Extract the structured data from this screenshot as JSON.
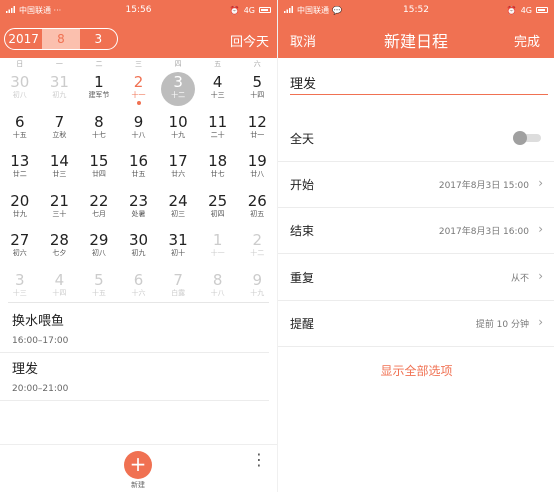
{
  "colors": {
    "accent": "#f07152",
    "selected_day": "#bdbdbd"
  },
  "left": {
    "status": {
      "carrier": "中国联通 ···",
      "time": "15:56",
      "network": "4G"
    },
    "header": {
      "year": "2017",
      "month": "8",
      "view": "3",
      "back_today": "回今天"
    },
    "weekdays": [
      "日",
      "一",
      "二",
      "三",
      "四",
      "五",
      "六"
    ],
    "calendar": [
      [
        {
          "n": "30",
          "l": "初八",
          "dim": true
        },
        {
          "n": "31",
          "l": "初九",
          "dim": true
        },
        {
          "n": "1",
          "l": "建军节"
        },
        {
          "n": "2",
          "l": "十一",
          "today": true,
          "dot": true
        },
        {
          "n": "3",
          "l": "十二",
          "sel": true
        },
        {
          "n": "4",
          "l": "十三"
        },
        {
          "n": "5",
          "l": "十四"
        }
      ],
      [
        {
          "n": "6",
          "l": "十五"
        },
        {
          "n": "7",
          "l": "立秋"
        },
        {
          "n": "8",
          "l": "十七"
        },
        {
          "n": "9",
          "l": "十八"
        },
        {
          "n": "10",
          "l": "十九"
        },
        {
          "n": "11",
          "l": "二十"
        },
        {
          "n": "12",
          "l": "廿一"
        }
      ],
      [
        {
          "n": "13",
          "l": "廿二"
        },
        {
          "n": "14",
          "l": "廿三"
        },
        {
          "n": "15",
          "l": "廿四"
        },
        {
          "n": "16",
          "l": "廿五"
        },
        {
          "n": "17",
          "l": "廿六"
        },
        {
          "n": "18",
          "l": "廿七"
        },
        {
          "n": "19",
          "l": "廿八"
        }
      ],
      [
        {
          "n": "20",
          "l": "廿九"
        },
        {
          "n": "21",
          "l": "三十"
        },
        {
          "n": "22",
          "l": "七月"
        },
        {
          "n": "23",
          "l": "处暑"
        },
        {
          "n": "24",
          "l": "初三"
        },
        {
          "n": "25",
          "l": "初四"
        },
        {
          "n": "26",
          "l": "初五"
        }
      ],
      [
        {
          "n": "27",
          "l": "初六"
        },
        {
          "n": "28",
          "l": "七夕"
        },
        {
          "n": "29",
          "l": "初八"
        },
        {
          "n": "30",
          "l": "初九"
        },
        {
          "n": "31",
          "l": "初十"
        },
        {
          "n": "1",
          "l": "十一",
          "dim": true
        },
        {
          "n": "2",
          "l": "十二",
          "dim": true
        }
      ],
      [
        {
          "n": "3",
          "l": "十三",
          "dim": true
        },
        {
          "n": "4",
          "l": "十四",
          "dim": true
        },
        {
          "n": "5",
          "l": "十五",
          "dim": true
        },
        {
          "n": "6",
          "l": "十六",
          "dim": true
        },
        {
          "n": "7",
          "l": "白露",
          "dim": true
        },
        {
          "n": "8",
          "l": "十八",
          "dim": true
        },
        {
          "n": "9",
          "l": "十九",
          "dim": true
        }
      ]
    ],
    "events": [
      {
        "title": "换水喂鱼",
        "time": "16:00–17:00"
      },
      {
        "title": "理发",
        "time": "20:00–21:00"
      }
    ],
    "bottom": {
      "add_symbol": "+",
      "add_label": "新建",
      "more_symbol": "⋮"
    }
  },
  "right": {
    "status": {
      "carrier": "中国联通",
      "time": "15:52",
      "network": "4G"
    },
    "header": {
      "cancel": "取消",
      "title": "新建日程",
      "done": "完成"
    },
    "title_value": "理发",
    "rows": {
      "all_day": {
        "label": "全天"
      },
      "start": {
        "label": "开始",
        "value": "2017年8月3日  15:00"
      },
      "end": {
        "label": "结束",
        "value": "2017年8月3日  16:00"
      },
      "repeat": {
        "label": "重复",
        "value": "从不"
      },
      "reminder": {
        "label": "提醒",
        "value": "提前 10 分钟"
      }
    },
    "show_all": "显示全部选项",
    "chevron": "›"
  }
}
